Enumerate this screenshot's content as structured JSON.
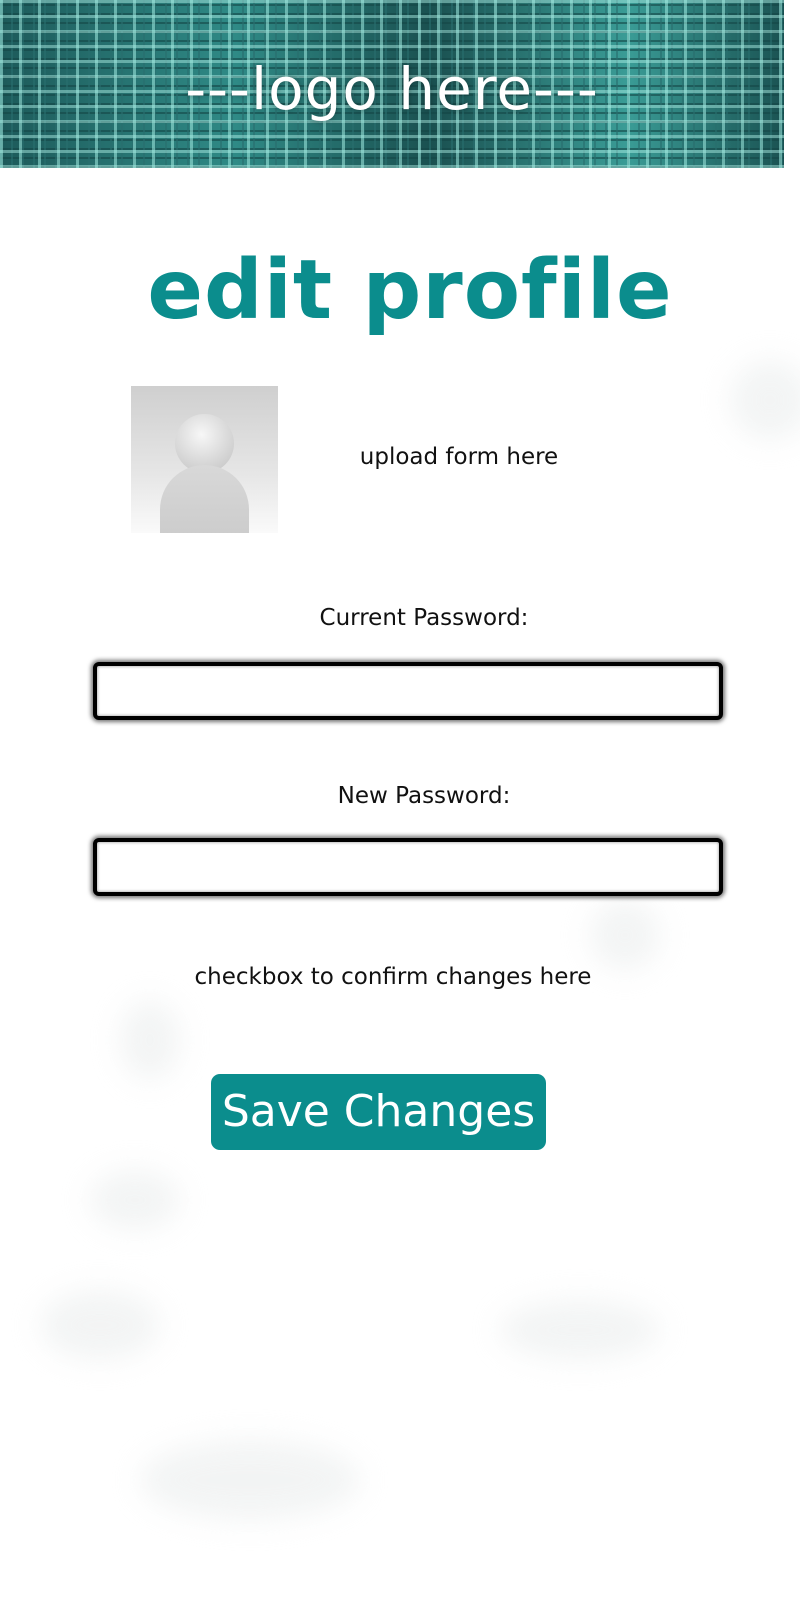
{
  "header": {
    "logo_text": "---logo here---"
  },
  "page": {
    "title": "edit profile"
  },
  "profile": {
    "avatar_icon": "user-silhouette-icon",
    "upload_text": "upload form here"
  },
  "form": {
    "current_password_label": "Current Password:",
    "current_password_value": "",
    "new_password_label": "New Password:",
    "new_password_value": "",
    "confirm_text": "checkbox to confirm changes here",
    "save_label": "Save Changes"
  },
  "colors": {
    "accent": "#0b8d8d",
    "header_dark": "#0f3a3a",
    "header_light": "#a0ebe1"
  }
}
